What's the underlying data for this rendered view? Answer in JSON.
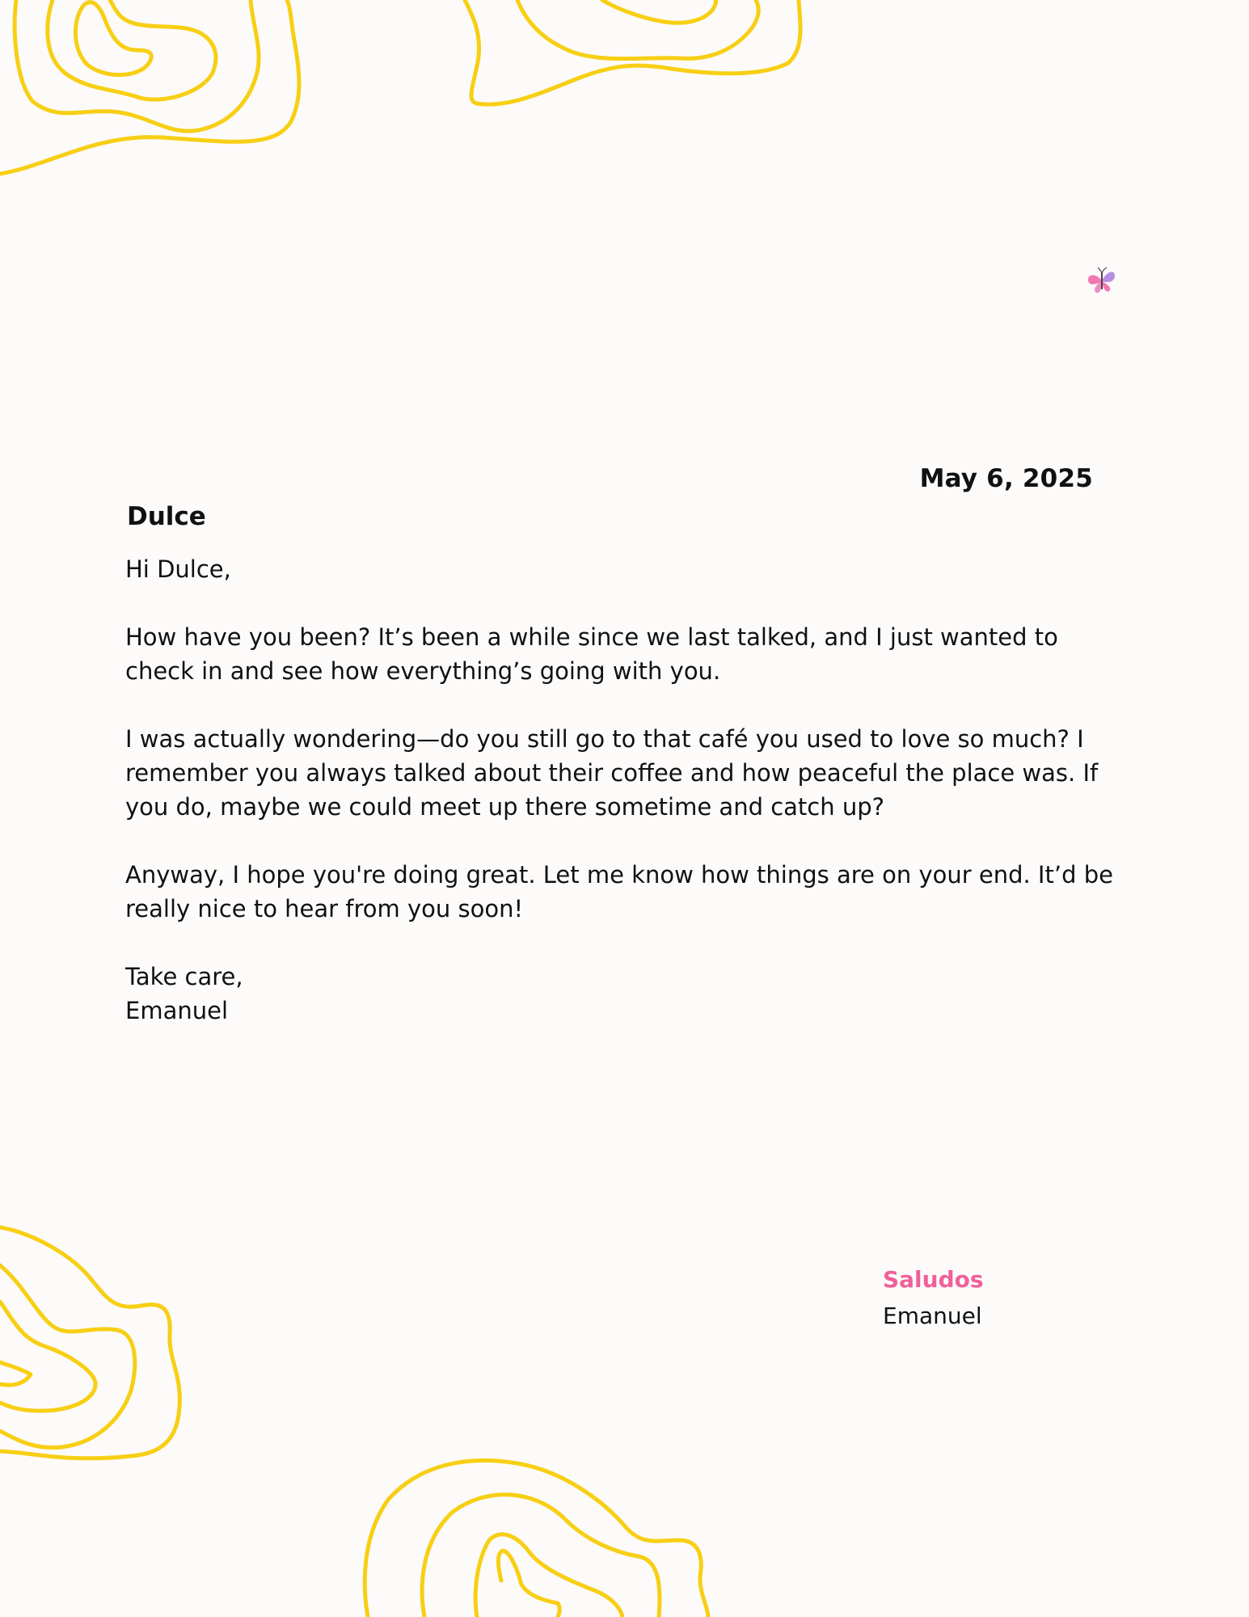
{
  "letter": {
    "date": "May 6, 2025",
    "recipient": "Dulce",
    "greeting": "Hi Dulce,",
    "paragraphs": [
      "How have you been? It’s been a while since we last talked, and I just wanted to check in and see how everything’s going with you.",
      "I was actually wondering—do you still go to that café you used to love so much? I remember you always talked about their coffee and how peaceful the place was. If you do, maybe we could meet up there sometime and catch up?",
      "Anyway, I hope you're doing great. Let me know how things are on your end. It’d be really nice to hear from you soon!"
    ],
    "closing": "Take care,",
    "closing_name": "Emanuel"
  },
  "signature": {
    "label": "Saludos",
    "name": "Emanuel"
  },
  "colors": {
    "background": "#fdfafa",
    "swirl": "#f7cf14",
    "accent": "#f0609a",
    "text": "#111111"
  },
  "icons": {
    "decoration": "butterfly-icon",
    "pattern": "swirl-pattern"
  }
}
